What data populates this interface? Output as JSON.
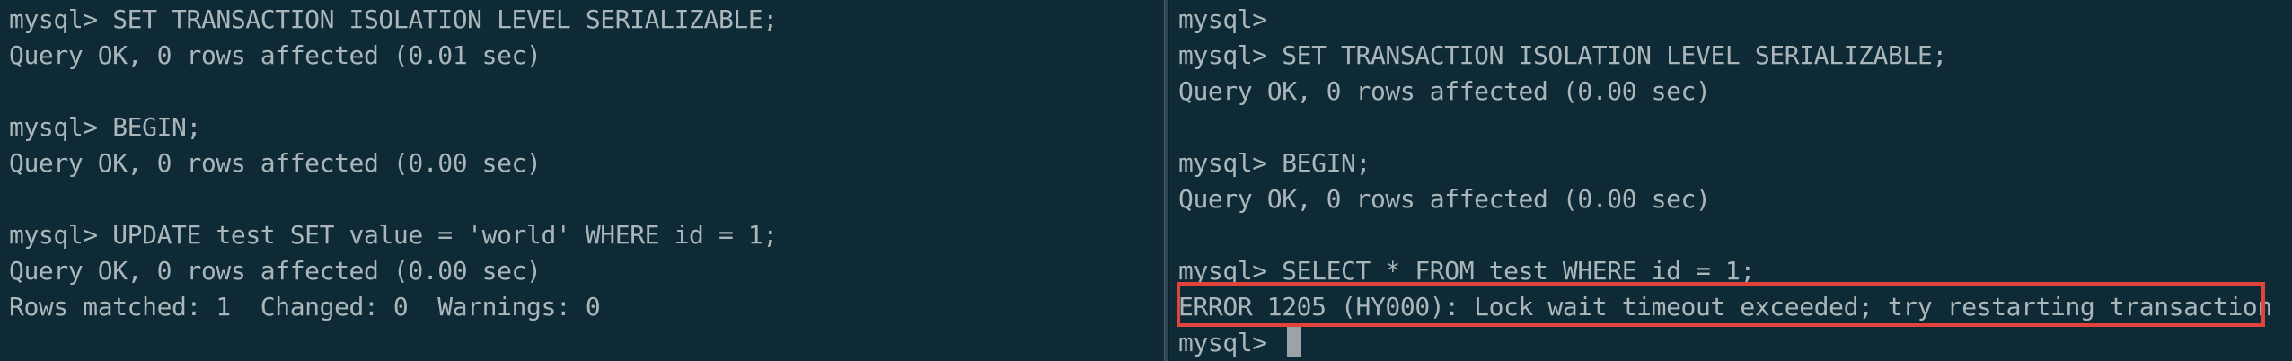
{
  "left_terminal": {
    "lines": [
      "mysql> SET TRANSACTION ISOLATION LEVEL SERIALIZABLE;",
      "Query OK, 0 rows affected (0.01 sec)",
      "",
      "mysql> BEGIN;",
      "Query OK, 0 rows affected (0.00 sec)",
      "",
      "mysql> UPDATE test SET value = 'world' WHERE id = 1;",
      "Query OK, 0 rows affected (0.00 sec)",
      "Rows matched: 1  Changed: 0  Warnings: 0"
    ]
  },
  "right_terminal": {
    "lines": [
      "mysql>",
      "mysql> SET TRANSACTION ISOLATION LEVEL SERIALIZABLE;",
      "Query OK, 0 rows affected (0.00 sec)",
      "",
      "mysql> BEGIN;",
      "Query OK, 0 rows affected (0.00 sec)",
      "",
      "mysql> SELECT * FROM test WHERE id = 1;",
      "ERROR 1205 (HY000): Lock wait timeout exceeded; try restarting transaction",
      "mysql> "
    ]
  },
  "colors": {
    "background": "#0d2a36",
    "text": "#aab6b9",
    "highlight_border": "#e2443b"
  }
}
